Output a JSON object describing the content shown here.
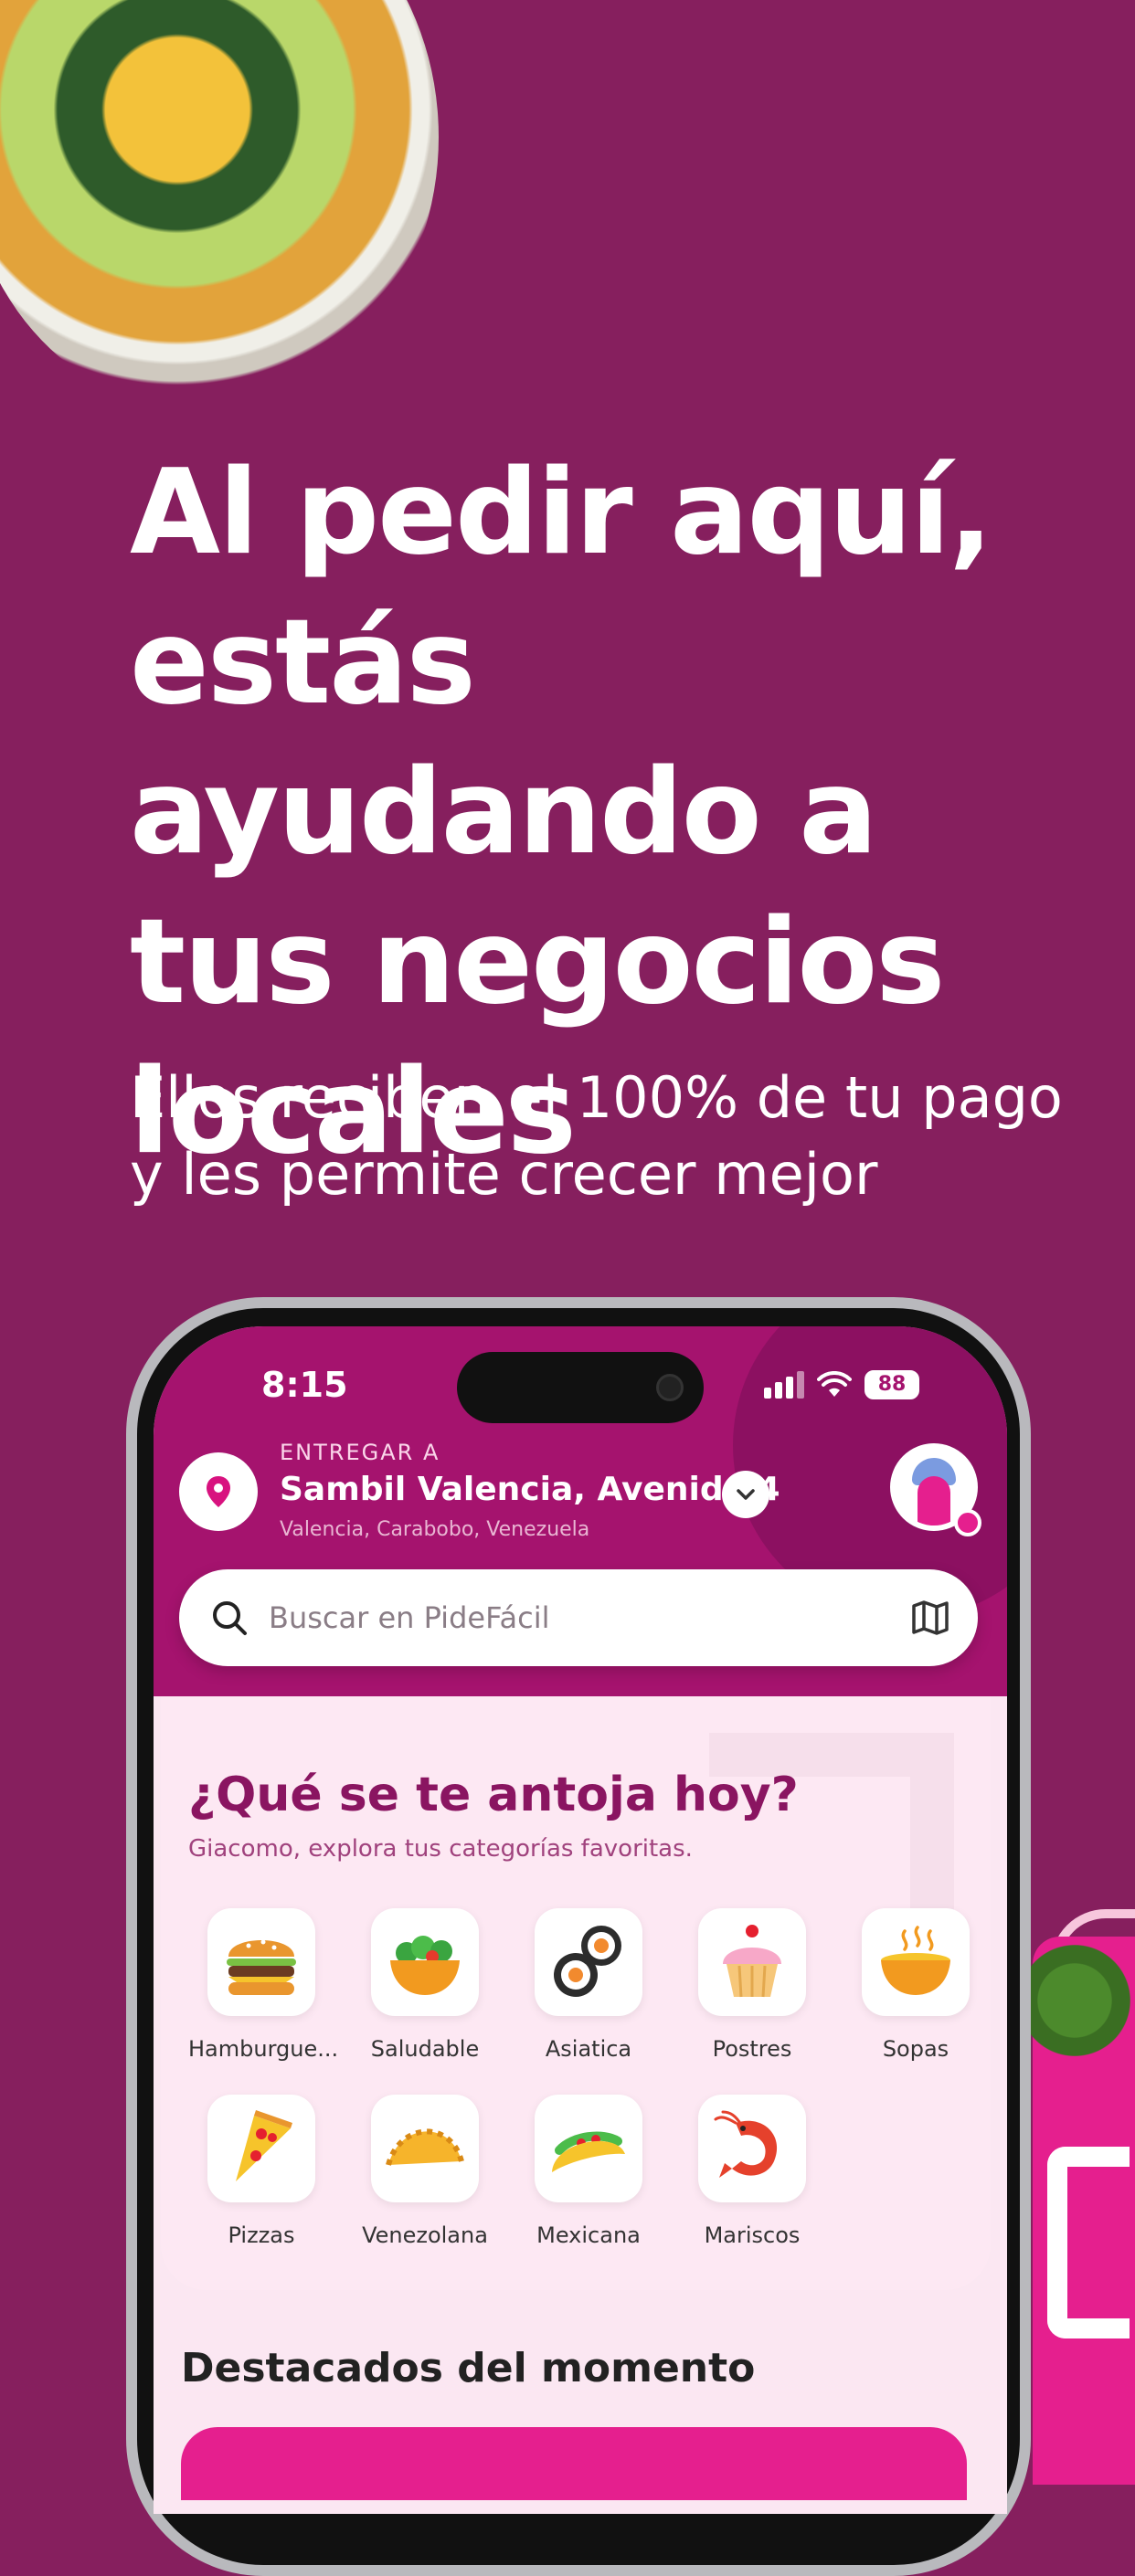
{
  "promo": {
    "headline": "Al pedir aquí, estás ayudando a tus negocios locales",
    "subline": "Ellos reciben el 100% de tu pago y les permite crecer mejor"
  },
  "status_bar": {
    "time": "8:15",
    "battery": "88",
    "icons": [
      "signal-icon",
      "wifi-icon",
      "battery-icon"
    ]
  },
  "header": {
    "deliver_label": "ENTREGAR A",
    "address": "Sambil Valencia, Avenida 4",
    "city": "Valencia, Carabobo, Venezuela"
  },
  "search": {
    "placeholder": "Buscar en PideFácil"
  },
  "categories_section": {
    "title": "¿Qué se te antoja hoy?",
    "subtitle": "Giacomo, explora tus categorías favoritas.",
    "items": [
      {
        "label": "Hamburgue...",
        "icon": "burger-icon"
      },
      {
        "label": "Saludable",
        "icon": "salad-icon"
      },
      {
        "label": "Asiatica",
        "icon": "sushi-icon"
      },
      {
        "label": "Postres",
        "icon": "cupcake-icon"
      },
      {
        "label": "Sopas",
        "icon": "soup-icon"
      },
      {
        "label": "Pizzas",
        "icon": "pizza-icon"
      },
      {
        "label": "Venezolana",
        "icon": "empanada-icon"
      },
      {
        "label": "Mexicana",
        "icon": "taco-icon"
      },
      {
        "label": "Mariscos",
        "icon": "shrimp-icon"
      }
    ]
  },
  "featured": {
    "title": "Destacados del momento"
  },
  "colors": {
    "background": "#861f5e",
    "header": "#a5136e",
    "accent": "#e51f8e",
    "title": "#8a1561"
  }
}
